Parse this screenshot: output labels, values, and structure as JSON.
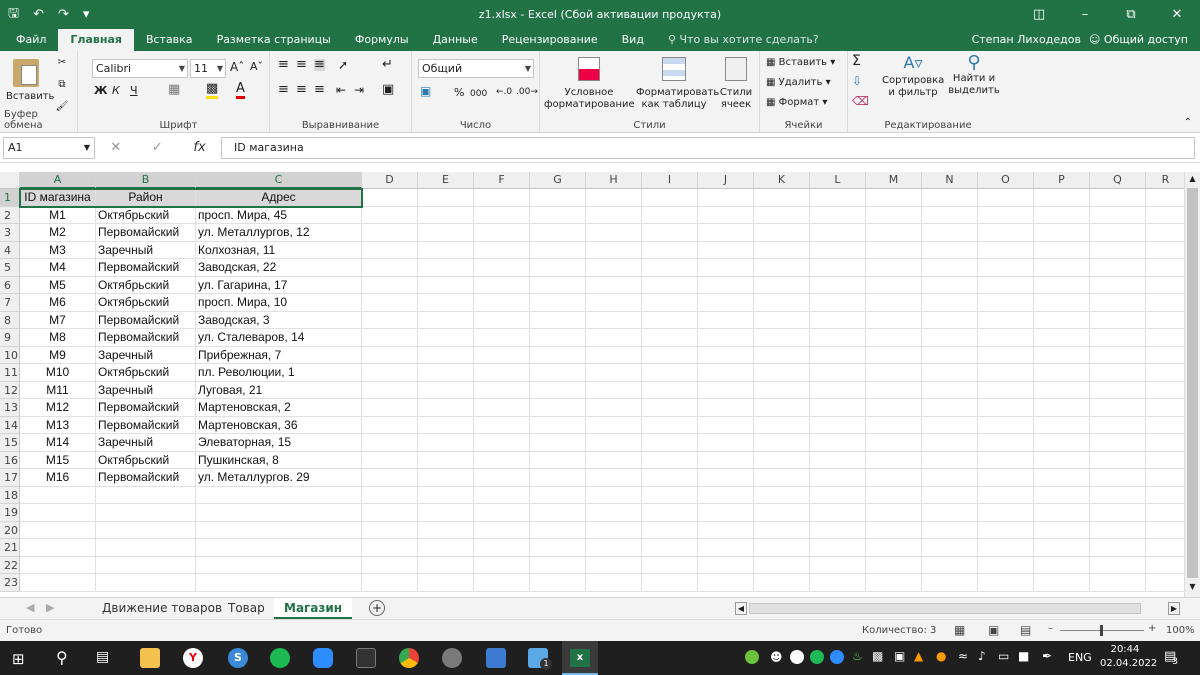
{
  "window": {
    "title": "z1.xlsx  -  Excel (Сбой активации продукта)"
  },
  "tabs": [
    "Файл",
    "Главная",
    "Вставка",
    "Разметка страницы",
    "Формулы",
    "Данные",
    "Рецензирование",
    "Вид"
  ],
  "tell_me": "Что вы хотите сделать?",
  "user": "Степан Лиходедов",
  "share": "Общий доступ",
  "ribbon": {
    "paste": "Вставить",
    "font_name": "Calibri",
    "font_size": "11",
    "bold": "Ж",
    "italic": "К",
    "underline": "Ч",
    "number_format": "Общий",
    "percent": "%",
    "thousands": "000",
    "cond_format": "Условное форматирование",
    "format_table": "Форматировать как таблицу",
    "cell_styles": "Стили ячеек",
    "insert": "Вставить",
    "delete": "Удалить",
    "format": "Формат",
    "sort_filter": "Сортировка и фильтр",
    "find_select": "Найти и выделить",
    "groups": [
      "Буфер обмена",
      "Шрифт",
      "Выравнивание",
      "Число",
      "Стили",
      "Ячейки",
      "Редактирование"
    ]
  },
  "formula_bar": {
    "name_box": "A1",
    "fx": "fx",
    "content": "ID магазина"
  },
  "columns": [
    "A",
    "B",
    "C",
    "D",
    "E",
    "F",
    "G",
    "H",
    "I",
    "J",
    "K",
    "L",
    "M",
    "N",
    "O",
    "P",
    "Q",
    "R"
  ],
  "rows": [
    "1",
    "2",
    "3",
    "4",
    "5",
    "6",
    "7",
    "8",
    "9",
    "10",
    "11",
    "12",
    "13",
    "14",
    "15",
    "16",
    "17",
    "18",
    "19",
    "20",
    "21",
    "22",
    "23"
  ],
  "table": {
    "headers": [
      "ID магазина",
      "Район",
      "Адрес"
    ],
    "data": [
      [
        "М1",
        "Октябрьский",
        "просп. Мира, 45"
      ],
      [
        "М2",
        "Первомайский",
        "ул. Металлургов, 12"
      ],
      [
        "М3",
        "Заречный",
        "Колхозная, 11"
      ],
      [
        "М4",
        "Первомайский",
        "Заводская, 22"
      ],
      [
        "М5",
        "Октябрьский",
        "ул. Гагарина, 17"
      ],
      [
        "М6",
        "Октябрьский",
        "просп. Мира, 10"
      ],
      [
        "М7",
        "Первомайский",
        "Заводская, 3"
      ],
      [
        "М8",
        "Первомайский",
        "ул. Сталеваров, 14"
      ],
      [
        "М9",
        "Заречный",
        "Прибрежная, 7"
      ],
      [
        "М10",
        "Октябрьский",
        "пл. Революции, 1"
      ],
      [
        "М11",
        "Заречный",
        "Луговая, 21"
      ],
      [
        "М12",
        "Первомайский",
        "Мартеновская, 2"
      ],
      [
        "М13",
        "Первомайский",
        "Мартеновская, 36"
      ],
      [
        "М14",
        "Заречный",
        "Элеваторная, 15"
      ],
      [
        "М15",
        "Октябрьский",
        "Пушкинская, 8"
      ],
      [
        "М16",
        "Первомайский",
        "ул. Металлургов. 29"
      ]
    ]
  },
  "sheets": [
    "Движение товаров",
    "Товар",
    "Магазин"
  ],
  "active_sheet": "Магазин",
  "status": {
    "ready": "Готово",
    "count": "Количество: 3",
    "zoom": "100%"
  },
  "taskbar": {
    "lang": "ENG",
    "time": "20:44",
    "date": "02.04.2022",
    "notif": "3",
    "badge": "1"
  },
  "colors": {
    "accent": "#217346",
    "taskbar": "#1f1f1f"
  }
}
